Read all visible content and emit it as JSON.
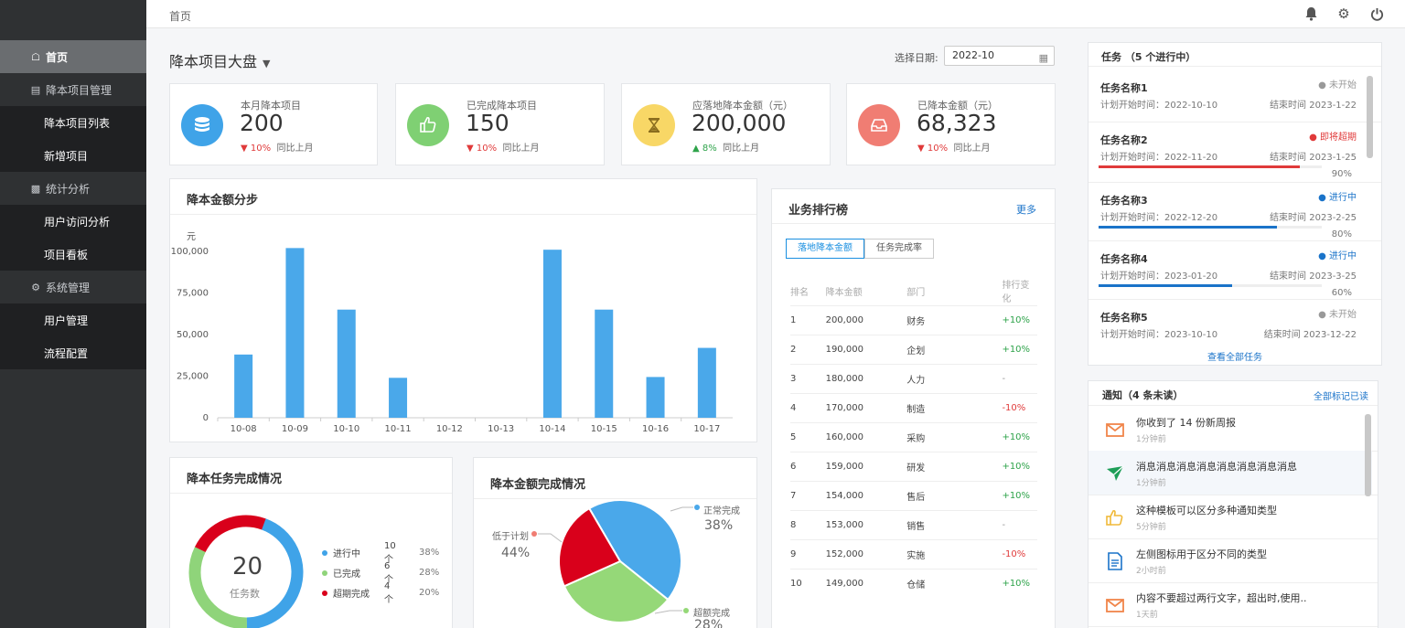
{
  "topbar": {
    "breadcrumb": "首页",
    "icons": [
      "bell-icon",
      "gear-icon",
      "power-icon"
    ]
  },
  "sidebar": {
    "items": [
      {
        "label": "首页",
        "icon": "home-icon",
        "active": true
      },
      {
        "label": "降本项目管理",
        "icon": "card-icon"
      },
      {
        "label": "降本项目列表",
        "sub": true
      },
      {
        "label": "新增项目",
        "sub": true
      },
      {
        "label": "统计分析",
        "icon": "bar-chart-icon"
      },
      {
        "label": "用户访问分析",
        "sub": true
      },
      {
        "label": "项目看板",
        "sub": true
      },
      {
        "label": "系统管理",
        "icon": "gear-icon"
      },
      {
        "label": "用户管理",
        "sub": true
      },
      {
        "label": "流程配置",
        "sub": true
      }
    ]
  },
  "header": {
    "title": "降本项目大盘",
    "date_label": "选择日期:",
    "date_value": "2022-10"
  },
  "stats": [
    {
      "label": "本月降本项目",
      "value": "200",
      "change": "10%",
      "dir": "down",
      "compare": "同比上月",
      "color": "#3fa3e8",
      "icon": "database-icon"
    },
    {
      "label": "已完成降本项目",
      "value": "150",
      "change": "10%",
      "dir": "down",
      "compare": "同比上月",
      "color": "#7fd073",
      "icon": "thumbs-up-icon"
    },
    {
      "label": "应落地降本金额（元）",
      "value": "200,000",
      "change": "8%",
      "dir": "up",
      "compare": "同比上月",
      "color": "#f8d766",
      "icon": "hourglass-icon"
    },
    {
      "label": "已降本金额（元）",
      "value": "68,323",
      "change": "10%",
      "dir": "down",
      "compare": "同比上月",
      "color": "#f07d73",
      "icon": "inbox-icon"
    }
  ],
  "bar_panel": {
    "title": "降本金额分步"
  },
  "chart_data": [
    {
      "type": "bar",
      "ylabel": "元",
      "categories": [
        "10-08",
        "10-09",
        "10-10",
        "10-11",
        "10-12",
        "10-13",
        "10-14",
        "10-15",
        "10-16",
        "10-17"
      ],
      "values": [
        38000,
        102000,
        65000,
        24000,
        0,
        0,
        101000,
        65000,
        24500,
        42000
      ],
      "ylim": [
        0,
        100000
      ],
      "yticks": [
        "0",
        "25,000",
        "50,000",
        "75,000",
        "100,000"
      ],
      "grid": false,
      "color": "#4aa8ea"
    },
    {
      "type": "pie",
      "subtype": "donut",
      "center_value": "20",
      "center_label": "任务数",
      "slices": [
        {
          "name": "进行中",
          "count": "10个",
          "pct": "38%",
          "value": 38,
          "color": "#3fa3e8"
        },
        {
          "name": "已完成",
          "count": "6个",
          "pct": "28%",
          "value": 28,
          "color": "#8fd47a"
        },
        {
          "name": "超期完成",
          "count": "4个",
          "pct": "20%",
          "value": 20,
          "color": "#d9001b"
        }
      ]
    },
    {
      "type": "pie",
      "slices": [
        {
          "name": "正常完成",
          "pct": "38%",
          "value": 38,
          "color": "#4aa8ea"
        },
        {
          "name": "超额完成",
          "pct": "28%",
          "value": 28,
          "color": "#95d878"
        },
        {
          "name": "低于计划",
          "pct": "44%",
          "value": 20,
          "color": "#d9001b"
        }
      ]
    }
  ],
  "donut_panel": {
    "title": "降本任务完成情况"
  },
  "pie_panel": {
    "title": "降本金额完成情况"
  },
  "ranking": {
    "title": "业务排行榜",
    "more": "更多",
    "tabs": [
      "落地降本金额",
      "任务完成率"
    ],
    "headers": [
      "排名",
      "降本金额",
      "部门",
      "排行变化"
    ],
    "rows": [
      {
        "rank": "1",
        "amount": "200,000",
        "dept": "财务",
        "change": "+10%",
        "dir": "up"
      },
      {
        "rank": "2",
        "amount": "190,000",
        "dept": "企划",
        "change": "+10%",
        "dir": "up"
      },
      {
        "rank": "3",
        "amount": "180,000",
        "dept": "人力",
        "change": "-",
        "dir": "flat"
      },
      {
        "rank": "4",
        "amount": "170,000",
        "dept": "制造",
        "change": "-10%",
        "dir": "down"
      },
      {
        "rank": "5",
        "amount": "160,000",
        "dept": "采购",
        "change": "+10%",
        "dir": "up"
      },
      {
        "rank": "6",
        "amount": "159,000",
        "dept": "研发",
        "change": "+10%",
        "dir": "up"
      },
      {
        "rank": "7",
        "amount": "154,000",
        "dept": "售后",
        "change": "+10%",
        "dir": "up"
      },
      {
        "rank": "8",
        "amount": "153,000",
        "dept": "销售",
        "change": "-",
        "dir": "flat"
      },
      {
        "rank": "9",
        "amount": "152,000",
        "dept": "实施",
        "change": "-10%",
        "dir": "down"
      },
      {
        "rank": "10",
        "amount": "149,000",
        "dept": "仓储",
        "change": "+10%",
        "dir": "up"
      }
    ]
  },
  "tasks": {
    "title": "任务 （5 个进行中）",
    "view_all": "查看全部任务",
    "items": [
      {
        "name": "任务名称1",
        "status": "● 未开始",
        "status_color": "#999999",
        "start": "计划开始时间：2022-10-10",
        "end": "结束时间 2023-1-22"
      },
      {
        "name": "任务名称2",
        "status": "● 即将超期",
        "status_color": "#e03a3a",
        "start": "计划开始时间：2022-11-20",
        "end": "结束时间 2023-1-25",
        "progress": 90,
        "pct": "90%",
        "bar_color": "#e03a3a"
      },
      {
        "name": "任务名称3",
        "status": "● 进行中",
        "status_color": "#1a73c9",
        "start": "计划开始时间：2022-12-20",
        "end": "结束时间 2023-2-25",
        "progress": 80,
        "pct": "80%",
        "bar_color": "#1a73c9"
      },
      {
        "name": "任务名称4",
        "status": "● 进行中",
        "status_color": "#1a73c9",
        "start": "计划开始时间：2023-01-20",
        "end": "结束时间 2023-3-25",
        "progress": 60,
        "pct": "60%",
        "bar_color": "#1a73c9"
      },
      {
        "name": "任务名称5",
        "status": "● 未开始",
        "status_color": "#999999",
        "start": "计划开始时间：2023-10-10",
        "end": "结束时间 2023-12-22"
      }
    ]
  },
  "notices": {
    "title": "通知（4 条未读）",
    "mark_all": "全部标记已读",
    "items": [
      {
        "text": "你收到了 14 份新周报",
        "time": "1分钟前",
        "icon": "mail-icon"
      },
      {
        "text": "消息消息消息消息消息消息消息消息",
        "time": "1分钟前",
        "icon": "paper-plane-icon"
      },
      {
        "text": "这种模板可以区分多种通知类型",
        "time": "5分钟前",
        "icon": "thumbs-up-icon"
      },
      {
        "text": "左侧图标用于区分不同的类型",
        "time": "2小时前",
        "icon": "document-icon"
      },
      {
        "text": "内容不要超过两行文字，超出时,使用..",
        "time": "1天前",
        "icon": "mail-icon"
      }
    ]
  }
}
